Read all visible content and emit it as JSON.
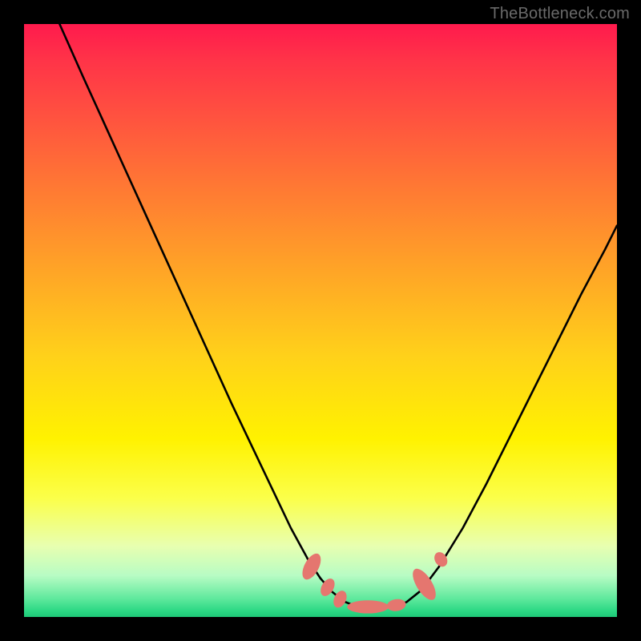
{
  "watermark": "TheBottleneck.com",
  "colors": {
    "curve_stroke": "#000000",
    "marker_fill": "#e5766f",
    "marker_stroke": "#d96a63"
  },
  "chart_data": {
    "type": "line",
    "title": "",
    "xlabel": "",
    "ylabel": "",
    "xlim": [
      0,
      100
    ],
    "ylim": [
      0,
      100
    ],
    "grid": false,
    "legend": false,
    "note": "Values are visual estimates read from plot geometry; x and y are percentages of the plot box (y=0 bottom, y=100 top).",
    "series": [
      {
        "name": "left-branch",
        "x": [
          6,
          10,
          15,
          20,
          25,
          30,
          35,
          40,
          45,
          48,
          50,
          52,
          54,
          55.5
        ],
        "y": [
          100,
          91,
          80,
          69,
          58,
          47,
          36,
          25.5,
          15,
          9.5,
          6.5,
          4.2,
          2.6,
          2.0
        ]
      },
      {
        "name": "valley-floor",
        "x": [
          55.5,
          57,
          59,
          61,
          63,
          64.5
        ],
        "y": [
          2.0,
          1.7,
          1.6,
          1.7,
          2.0,
          2.5
        ]
      },
      {
        "name": "right-branch",
        "x": [
          64.5,
          67,
          70,
          74,
          78,
          82,
          86,
          90,
          94,
          98,
          100
        ],
        "y": [
          2.5,
          4.5,
          8.5,
          15,
          22.5,
          30.5,
          38.5,
          46.5,
          54.5,
          62,
          66
        ]
      }
    ],
    "markers": [
      {
        "cx": 48.5,
        "cy": 8.5,
        "rx": 1.2,
        "ry": 2.4,
        "rot": 28
      },
      {
        "cx": 51.2,
        "cy": 5.0,
        "rx": 1.0,
        "ry": 1.6,
        "rot": 30
      },
      {
        "cx": 53.3,
        "cy": 3.0,
        "rx": 1.0,
        "ry": 1.5,
        "rot": 25
      },
      {
        "cx": 58.0,
        "cy": 1.7,
        "rx": 3.5,
        "ry": 1.1,
        "rot": 0
      },
      {
        "cx": 62.8,
        "cy": 2.0,
        "rx": 1.6,
        "ry": 1.0,
        "rot": -8
      },
      {
        "cx": 67.5,
        "cy": 5.5,
        "rx": 1.3,
        "ry": 3.0,
        "rot": -32
      },
      {
        "cx": 70.3,
        "cy": 9.7,
        "rx": 1.0,
        "ry": 1.3,
        "rot": -32
      }
    ]
  }
}
